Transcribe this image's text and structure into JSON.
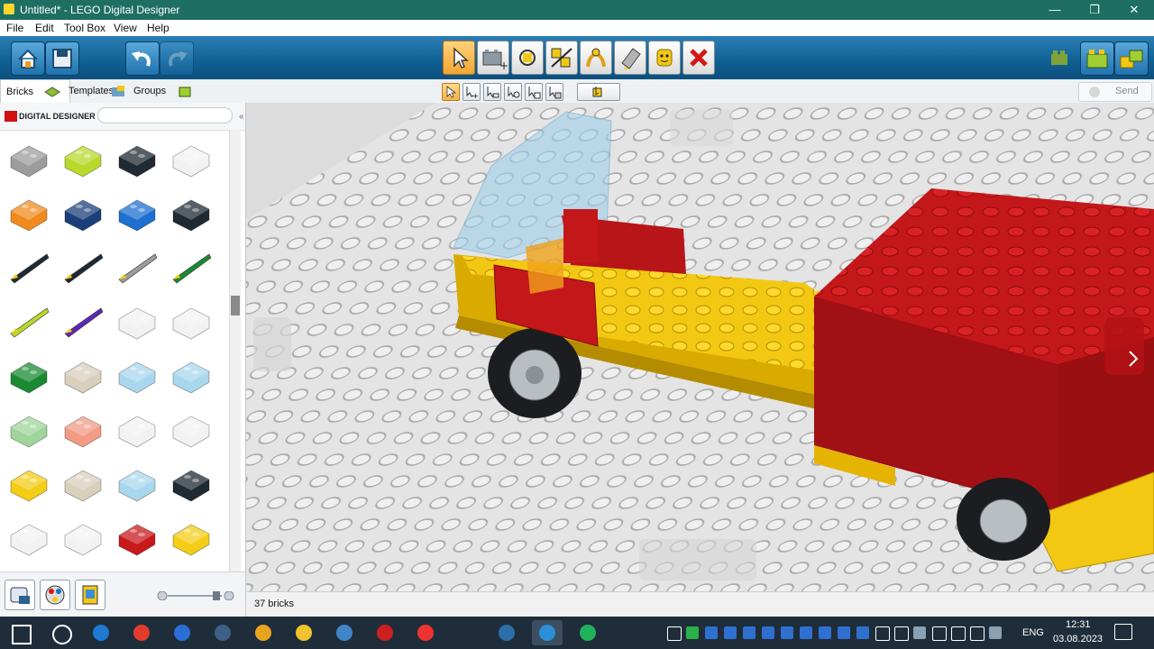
{
  "window": {
    "title": "Untitled* - LEGO Digital Designer",
    "minimize": "—",
    "maximize": "❐",
    "close": "✕"
  },
  "menu": [
    "File",
    "Edit",
    "Tool Box",
    "View",
    "Help"
  ],
  "toolbar": {
    "left_buttons": [
      "home-icon",
      "save-icon",
      "undo-icon",
      "redo-icon"
    ],
    "tools": [
      "select-icon",
      "clone-icon",
      "hinge-icon",
      "hinge-align-icon",
      "flex-icon",
      "paint-icon",
      "decorate-icon",
      "delete-icon"
    ],
    "right_buttons": [
      "build-mode-icon",
      "view-mode-icon",
      "building-guide-icon"
    ]
  },
  "tabs": [
    {
      "label": "Bricks",
      "icon": "brick-icon"
    },
    {
      "label": "Templates",
      "icon": "template-icon"
    },
    {
      "label": "Groups",
      "icon": "group-icon"
    }
  ],
  "send_label": "Send",
  "brand": {
    "logo_text": "DIGITAL DESIGNER",
    "search_placeholder": ""
  },
  "palette": {
    "colors": {
      "grey": "#9c9c9c",
      "lime": "#b8d92a",
      "black": "#1f2a33",
      "white": "#f2f2f2",
      "orange": "#f08a1c",
      "darkblue": "#1b3f7a",
      "blue": "#1e6fd0",
      "red": "#c8191b",
      "yellow": "#f3cd16",
      "green": "#1a8a32",
      "tan": "#d8cfbc",
      "trans_blue": "#a9d7ee",
      "sand_green": "#9fd49a",
      "salmon": "#f29b85",
      "purple": "#5d27b5"
    },
    "rows": [
      [
        "grey",
        "lime",
        "black",
        "white"
      ],
      [
        "orange",
        "darkblue",
        "blue",
        "black"
      ],
      [
        "black",
        "black",
        "grey",
        "green"
      ],
      [
        "lime",
        "purple",
        "white",
        "white"
      ],
      [
        "green",
        "tan",
        "trans_blue",
        "trans_blue"
      ],
      [
        "sand_green",
        "salmon",
        "white",
        "white"
      ],
      [
        "yellow",
        "tan",
        "trans_blue",
        "black"
      ],
      [
        "white",
        "white",
        "red",
        "yellow"
      ]
    ]
  },
  "status": {
    "brick_count": "37 bricks"
  },
  "taskbar": {
    "apps": [
      "start-icon",
      "search-icon",
      "edge-icon",
      "yandex-icon",
      "app-bolt-icon",
      "app-paint-icon",
      "chrome-icon",
      "explorer-icon",
      "qbittorrent-icon",
      "opera-icon",
      "yandex-browser-icon",
      "shield-icon",
      "app-monitor-icon",
      "lego-icon",
      "app-green-icon"
    ],
    "tray_text": "ENG",
    "time": "12:31",
    "date": "03.08.2023"
  },
  "scene_colors": {
    "yellow": "#f3c813",
    "red": "#c4171a",
    "baseplate": "#e3e3e3",
    "stud": "#cfcfcf",
    "tire": "#1b1d20"
  }
}
